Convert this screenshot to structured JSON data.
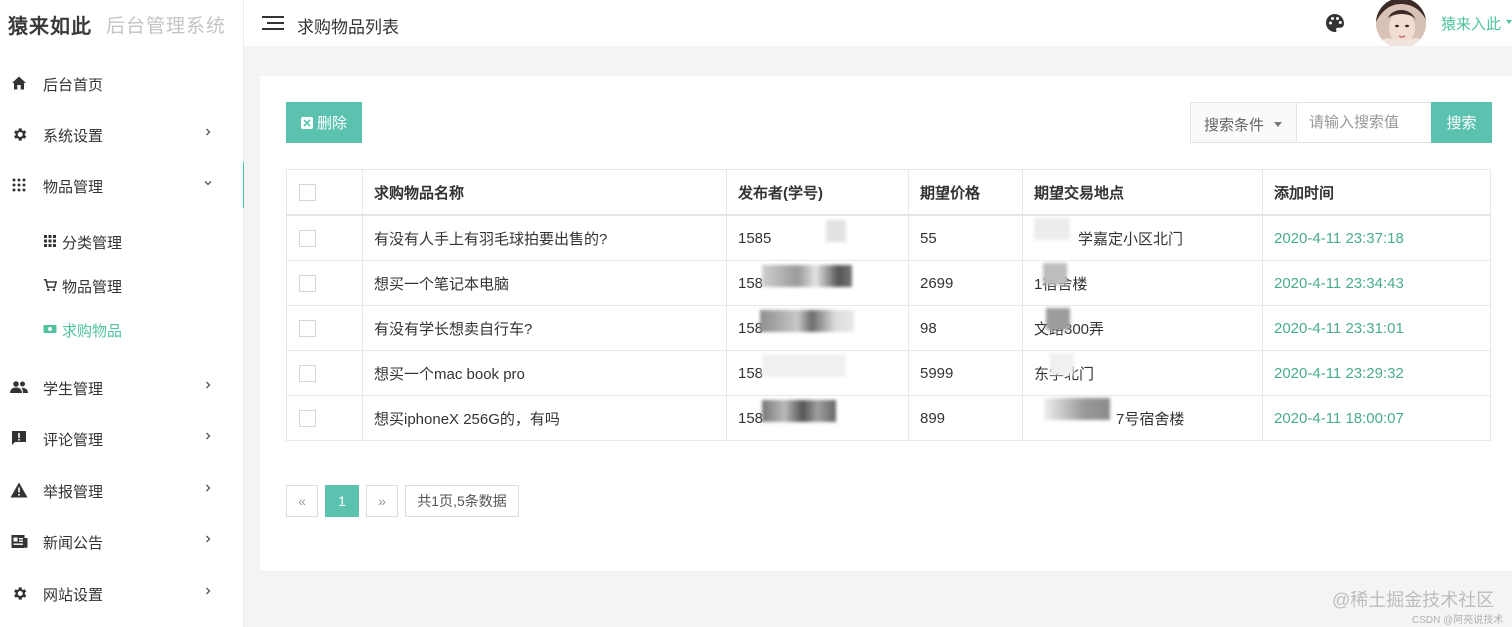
{
  "app": {
    "logo_main": "猿来如此",
    "logo_sub": "后台管理系统"
  },
  "header": {
    "title": "求购物品列表",
    "theme_icon": "palette-icon",
    "user_name": "猿来入此"
  },
  "sidebar": {
    "items": [
      {
        "label": "后台首页",
        "icon": "home-icon"
      },
      {
        "label": "系统设置",
        "icon": "gear-icon"
      },
      {
        "label": "物品管理",
        "icon": "grid-dots-icon",
        "expanded": true
      },
      {
        "label": "学生管理",
        "icon": "people-icon"
      },
      {
        "label": "评论管理",
        "icon": "comment-alert-icon"
      },
      {
        "label": "举报管理",
        "icon": "warning-icon"
      },
      {
        "label": "新闻公告",
        "icon": "news-icon"
      },
      {
        "label": "网站设置",
        "icon": "gear-icon"
      }
    ],
    "sub_items": [
      {
        "label": "分类管理",
        "icon": "grid-icon"
      },
      {
        "label": "物品管理",
        "icon": "cart-icon"
      },
      {
        "label": "求购物品",
        "icon": "money-icon",
        "active": true
      }
    ]
  },
  "toolbar": {
    "delete_label": "删除",
    "search_condition_label": "搜索条件",
    "search_placeholder": "请输入搜索值",
    "search_value": "",
    "search_button_label": "搜索"
  },
  "table": {
    "columns": [
      "",
      "求购物品名称",
      "发布者(学号)",
      "期望价格",
      "期望交易地点",
      "添加时间"
    ],
    "rows": [
      {
        "name": "有没有人手上有羽毛球拍要出售的?",
        "publisher": "1585",
        "price": "55",
        "location": "学嘉定小区北门",
        "time": "2020-4-11 23:37:18"
      },
      {
        "name": "想买一个笔记本电脑",
        "publisher": "158",
        "price": "2699",
        "location": "1宿舍楼",
        "time": "2020-4-11 23:34:43"
      },
      {
        "name": "有没有学长想卖自行车?",
        "publisher": "158",
        "price": "98",
        "location": "文路300弄",
        "time": "2020-4-11 23:31:01"
      },
      {
        "name": "想买一个mac book pro",
        "publisher": "158",
        "price": "5999",
        "location": "东学北门",
        "time": "2020-4-11 23:29:32"
      },
      {
        "name": "想买iphoneX 256G的，有吗",
        "publisher": "158",
        "price": "899",
        "location": "7号宿舍楼",
        "time": "2020-4-11 18:00:07"
      }
    ]
  },
  "pagination": {
    "prev": "«",
    "current": "1",
    "next": "»",
    "info": "共1页,5条数据"
  },
  "watermark": {
    "main": "@稀土掘金技术社区",
    "sub": "CSDN @阿亮说技术"
  },
  "colors": {
    "accent": "#5cc2b0",
    "time_green": "#4aae86",
    "sidebar_active_bar": "#4fc3a1"
  }
}
